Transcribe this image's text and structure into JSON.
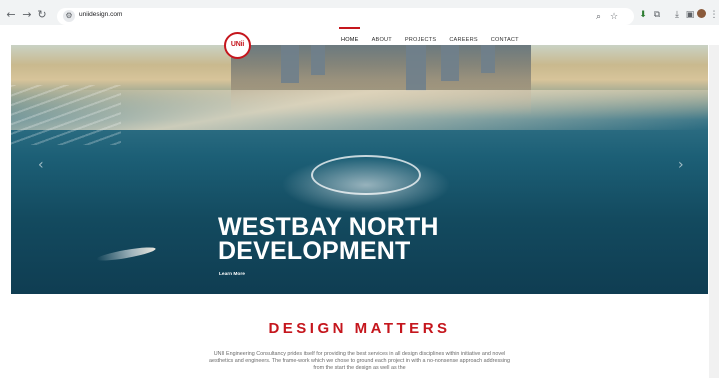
{
  "browser": {
    "url": "uniidesign.com",
    "icons": {
      "back": "back-arrow-icon",
      "forward": "forward-arrow-icon",
      "reload": "reload-icon",
      "site_info": "tune-icon",
      "zoom": "zoom-icon",
      "bookmark": "star-icon",
      "download": "download-icon",
      "extension": "puzzle-icon",
      "sidepanel": "sidepanel-icon",
      "profile": "avatar-icon",
      "menu": "kebab-menu-icon"
    }
  },
  "site": {
    "logo_text": "UNii",
    "brand_color": "#c5161d",
    "nav": [
      {
        "label": "HOME",
        "active": true
      },
      {
        "label": "ABOUT",
        "active": false
      },
      {
        "label": "PROJECTS",
        "active": false
      },
      {
        "label": "CAREERS",
        "active": false
      },
      {
        "label": "CONTACT",
        "active": false
      }
    ]
  },
  "hero": {
    "title_line1": "WESTBAY NORTH",
    "title_line2": "DEVELOPMENT",
    "cta": "Learn More"
  },
  "content": {
    "heading": "DESIGN MATTERS",
    "paragraph": "UNII Engineering Consultancy prides itself for providing the best services in all design disciplines within initiative and novel aesthetics and engineers. The frame-work which we chose to ground each project in with a no-nonsense approach addressing from the start the design as well as the"
  }
}
